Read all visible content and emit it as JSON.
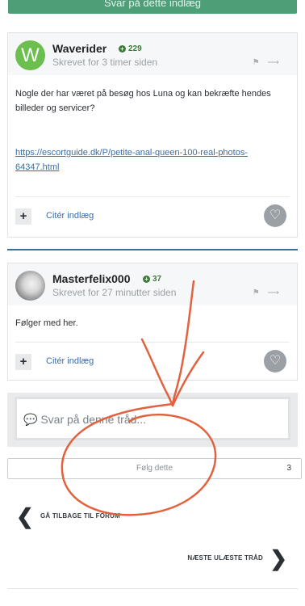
{
  "top_button": {
    "label": "Svar på dette indlæg"
  },
  "posts": [
    {
      "author": "Waverider",
      "avatar_letter": "W",
      "reputation": "229",
      "time": "Skrevet for 3 timer siden",
      "text": "Nogle der har været på besøg hos Luna og kan bekræfte hendes billeder og servicer?",
      "link": "https://escortguide.dk/P/petite-anal-queen-100-real-photos-64347.html",
      "quote_label": "Citér indlæg"
    },
    {
      "author": "Masterfelix000",
      "reputation": "37",
      "time": "Skrevet for 27 minutter siden",
      "text": "Følger med her.",
      "quote_label": "Citér indlæg"
    }
  ],
  "reply": {
    "placeholder": "Svar på denne tråd..."
  },
  "follow": {
    "label": "Følg dette",
    "count": "3"
  },
  "nav": {
    "back_label": "GÅ TILBAGE TIL FORUM",
    "next_label": "NÆSTE ULÆSTE TRÅD"
  },
  "icons": {
    "flag": "flag-icon",
    "share": "share-icon",
    "heart": "heart-icon",
    "comment": "comment-icon",
    "chevron_left": "chevron-left-icon",
    "chevron_right": "chevron-right-icon"
  },
  "colors": {
    "accent_green": "#4e9e78",
    "link_blue": "#3a6ea5",
    "annotation_orange": "#e2623f"
  }
}
